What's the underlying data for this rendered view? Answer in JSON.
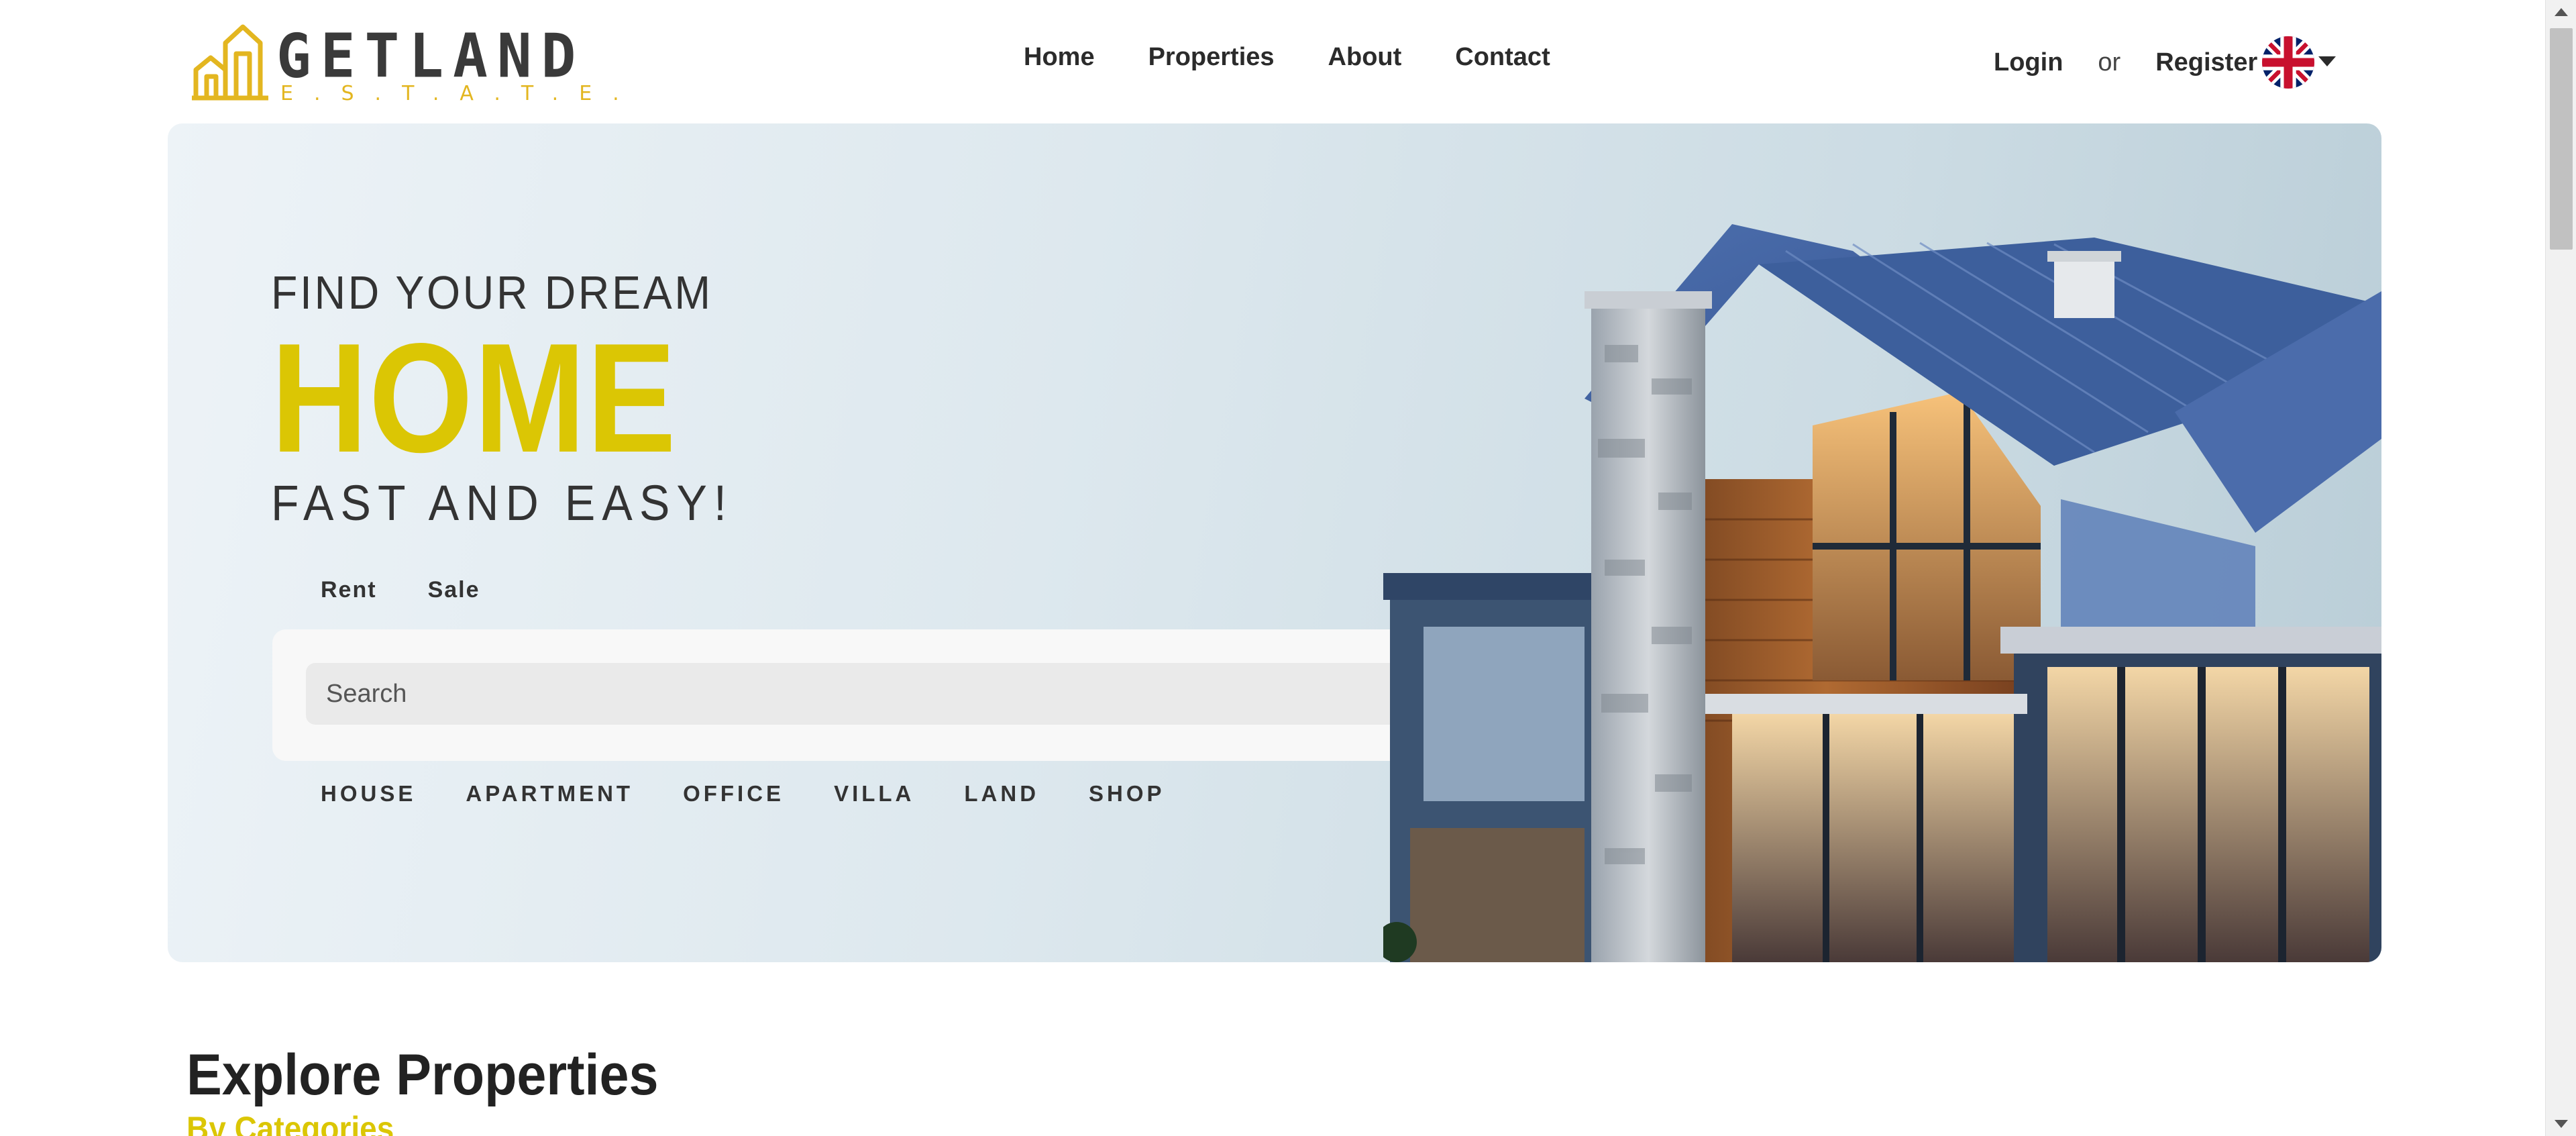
{
  "brand": {
    "name": "GETLAND",
    "tagline": "E.S.T.A.T.E.",
    "accent": "#dbc604",
    "logo_accent": "#e3b620"
  },
  "nav": {
    "items": [
      {
        "label": "Home"
      },
      {
        "label": "Properties"
      },
      {
        "label": "About"
      },
      {
        "label": "Contact"
      }
    ]
  },
  "auth": {
    "login": "Login",
    "or": "or",
    "register": "Register",
    "language_icon": "uk-flag-icon"
  },
  "hero": {
    "line1": "FIND YOUR DREAM",
    "line2": "HOME",
    "line3": "FAST AND EASY!",
    "deal_tabs": [
      {
        "label": "Rent"
      },
      {
        "label": "Sale"
      }
    ],
    "search": {
      "placeholder": "Search",
      "button_icon": "search-icon"
    },
    "property_types": [
      {
        "label": "HOUSE"
      },
      {
        "label": "APARTMENT"
      },
      {
        "label": "OFFICE"
      },
      {
        "label": "VILLA"
      },
      {
        "label": "LAND"
      },
      {
        "label": "SHOP"
      }
    ]
  },
  "explore": {
    "title": "Explore Properties",
    "subtitle": "By Categories"
  }
}
